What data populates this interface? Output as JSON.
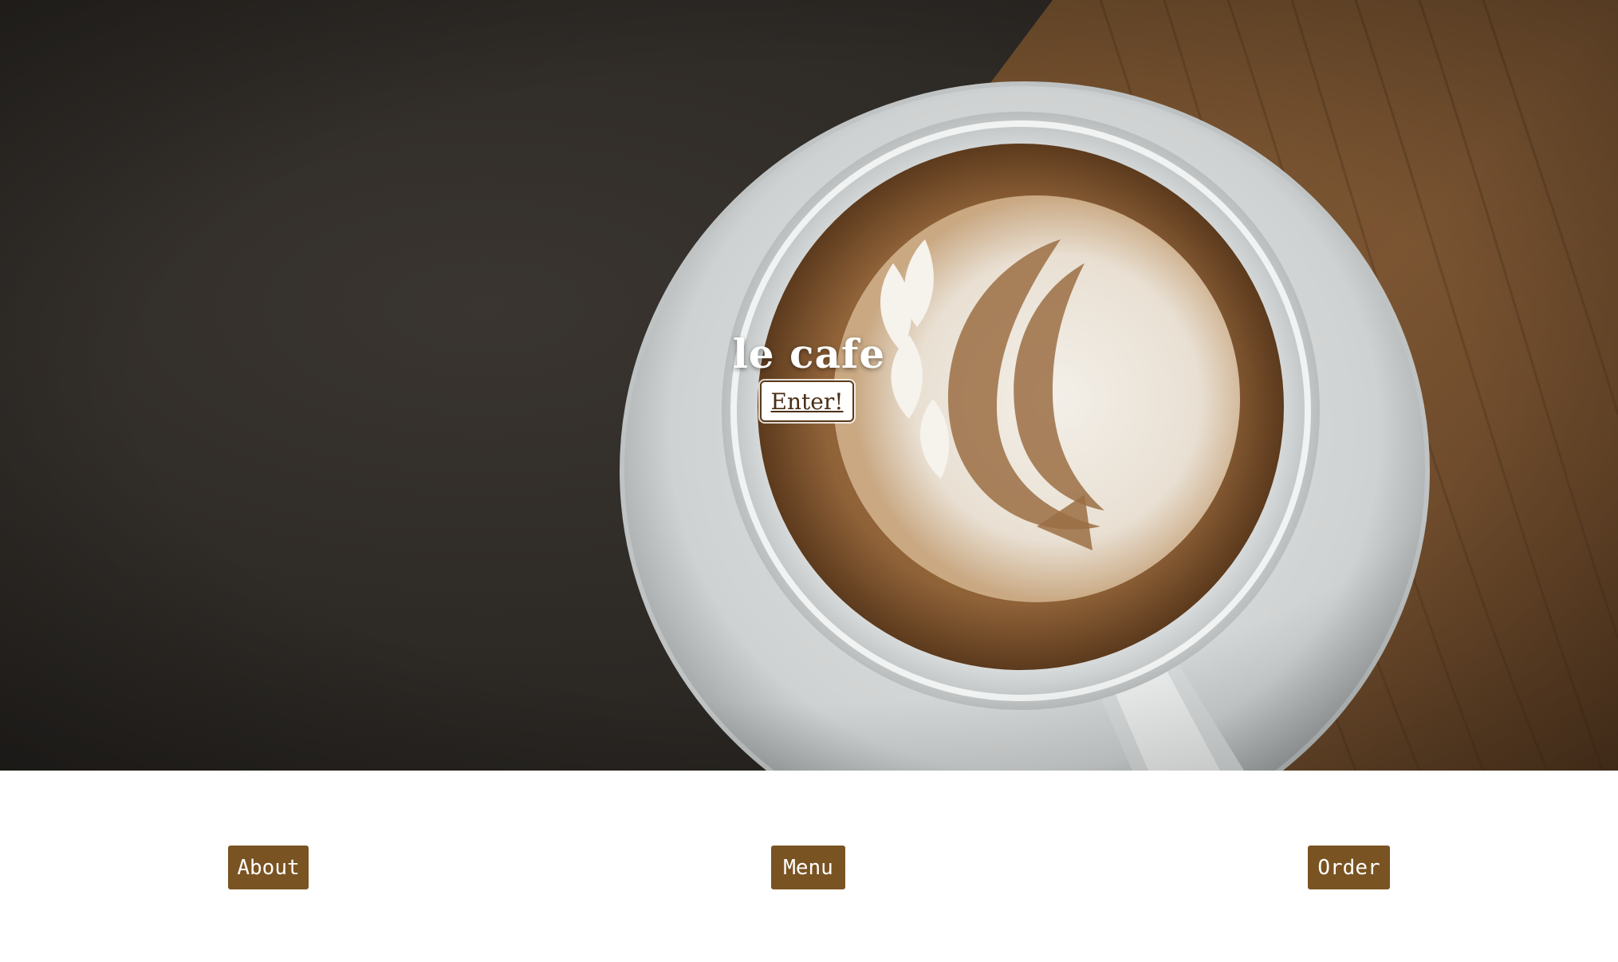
{
  "hero": {
    "title": "le cafe",
    "enter_label": "Enter!"
  },
  "nav": {
    "about_label": "About",
    "menu_label": "Menu",
    "order_label": "Order"
  },
  "colors": {
    "button_brown": "#7a5322",
    "title_white": "#ffffff"
  }
}
